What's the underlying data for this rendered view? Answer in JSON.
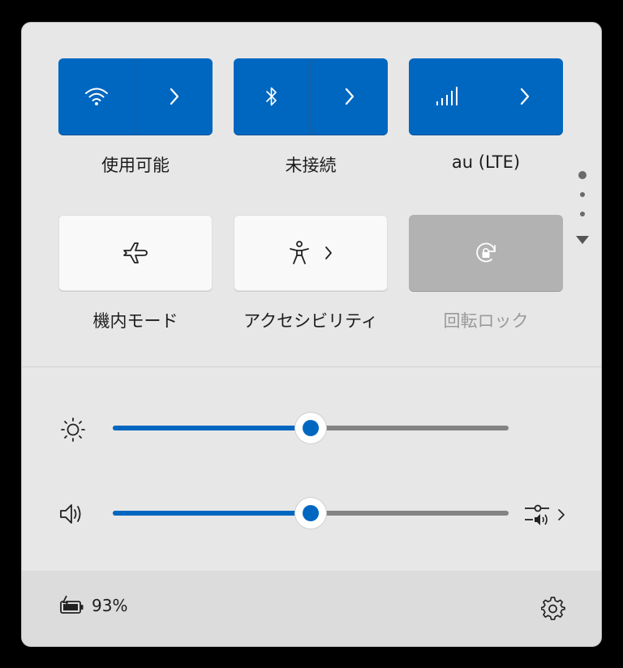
{
  "tiles": {
    "wifi": {
      "label": "使用可能",
      "icon": "wifi-icon"
    },
    "bluetooth": {
      "label": "未接続",
      "icon": "bluetooth-icon"
    },
    "cellular": {
      "label": "au (LTE)",
      "icon": "cellular-signal-icon"
    },
    "airplane": {
      "label": "機内モード",
      "icon": "airplane-icon"
    },
    "accessibility": {
      "label": "アクセシビリティ",
      "icon": "accessibility-icon"
    },
    "rotation_lock": {
      "label": "回転ロック",
      "icon": "rotation-lock-icon",
      "disabled": true
    }
  },
  "sliders": {
    "brightness": {
      "icon": "brightness-icon",
      "value_percent": 50
    },
    "volume": {
      "icon": "speaker-icon",
      "value_percent": 50
    }
  },
  "footer": {
    "battery_percent": "93%",
    "battery_icon": "battery-charging-icon",
    "settings_icon": "gear-icon"
  },
  "colors": {
    "accent": "#0067c0",
    "panel_background": "#e7e7e7",
    "disabled_tile": "#b2b2b2"
  }
}
